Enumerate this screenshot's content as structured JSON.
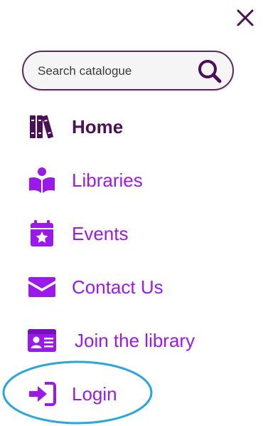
{
  "search": {
    "placeholder": "Search catalogue",
    "value": ""
  },
  "close": {
    "icon": "close-icon"
  },
  "nav": {
    "items": [
      {
        "label": "Home",
        "icon": "books-icon",
        "active": true
      },
      {
        "label": "Libraries",
        "icon": "reader-icon",
        "active": false
      },
      {
        "label": "Events",
        "icon": "calendar-star-icon",
        "active": false
      },
      {
        "label": "Contact Us",
        "icon": "envelope-icon",
        "active": false
      },
      {
        "label": "Join the library",
        "icon": "id-card-icon",
        "active": false
      },
      {
        "label": "Login",
        "icon": "sign-in-icon",
        "active": false
      }
    ]
  },
  "annotation": {
    "highlighted_item": "Login",
    "color": "#29a6dc"
  },
  "colors": {
    "accent": "#9b1aea",
    "active": "#4b1058",
    "border": "#5c2a5e"
  }
}
